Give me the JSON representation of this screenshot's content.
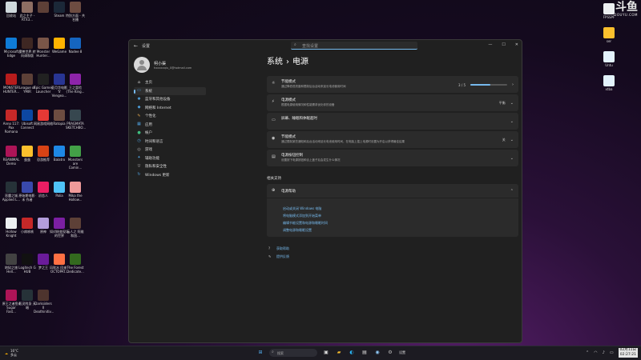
{
  "desktop_icons": [
    {
      "label": "回收站",
      "color": "#cfd8dc"
    },
    {
      "label": "此之主子 - RTX3...",
      "color": "#8d6e63"
    },
    {
      "label": "",
      "color": "#5d4037"
    },
    {
      "label": "Steam",
      "color": "#1b2838"
    },
    {
      "label": "特别方面 - 共名播",
      "color": "#6d4c41"
    },
    {
      "label": "Microsoft Edge",
      "color": "#0f7bd6"
    },
    {
      "label": "魔兽世界 转向调和版",
      "color": "#3e2723"
    },
    {
      "label": "Monster Hunter...",
      "color": "#795548"
    },
    {
      "label": "WeGame",
      "color": "#ffb300"
    },
    {
      "label": "Nadee 8",
      "color": "#1565c0"
    },
    {
      "label": "MONSTER HUNTER...",
      "color": "#b71c1c"
    },
    {
      "label": "League of YMIR",
      "color": "#5d4037"
    },
    {
      "label": "Epic Games Launcher",
      "color": "#212121"
    },
    {
      "label": "亚月华电影 'S' Vengea...",
      "color": "#283593"
    },
    {
      "label": "王之冒险 (The King...",
      "color": "#8e24aa"
    },
    {
      "label": "Anno 117: Pax Romana",
      "color": "#c62828"
    },
    {
      "label": "Ubisoft Connect",
      "color": "#0d47a1"
    },
    {
      "label": "网易游戏网络",
      "color": "#e53935"
    },
    {
      "label": "Ratopia",
      "color": "#6d4c41"
    },
    {
      "label": "PRAGMATA SKETCHBO...",
      "color": "#37474f"
    },
    {
      "label": "REANIMAL Demo",
      "color": "#ad1457"
    },
    {
      "label": "蛋蛋",
      "color": "#fbc02d"
    },
    {
      "label": "恐游推荐",
      "color": "#d84315"
    },
    {
      "label": "Balatro",
      "color": "#1e88e5"
    },
    {
      "label": "Monsters are Comin...",
      "color": "#43a047"
    },
    {
      "label": "恶魔之城 Applied L...",
      "color": "#263238"
    },
    {
      "label": "原始期电影·未 作者",
      "color": "#3949ab"
    },
    {
      "label": "初恋人",
      "color": "#e91e63"
    },
    {
      "label": "Palia",
      "color": "#4fc3f7"
    },
    {
      "label": "Mika the Hollow...",
      "color": "#ef9a9a"
    },
    {
      "label": "Hollow Knight",
      "color": "#eceff1"
    },
    {
      "label": "小病咳咳",
      "color": "#c62828"
    },
    {
      "label": "原神",
      "color": "#b39ddb"
    },
    {
      "label": "如对结变现场 的世界",
      "color": "#7b1fa2"
    },
    {
      "label": "云人之 阿维和加...",
      "color": "#5d4037"
    },
    {
      "label": "地狱之旅 Hell...",
      "color": "#424242"
    },
    {
      "label": "Logitech G HUB",
      "color": "#111"
    },
    {
      "label": "梦之王",
      "color": "#6a1b9a"
    },
    {
      "label": "风吹水 回来 - OCTOPAT...",
      "color": "#ff7043"
    },
    {
      "label": "The Forest Dedicate...",
      "color": "#33691e"
    },
    {
      "label": "原王之者鱼4 Sugar Fast...",
      "color": "#ad1457"
    },
    {
      "label": "恶灵附身 天暗",
      "color": "#263238"
    },
    {
      "label": "Darksiders II Deathinitiv...",
      "color": "#4e342e"
    }
  ],
  "right_icons": [
    {
      "label": "FPSSPF",
      "color": "#eceff1"
    },
    {
      "label": "ser",
      "color": "#fbc02d"
    },
    {
      "label": "Untu",
      "color": "#e3f2fd"
    },
    {
      "label": "xtba",
      "color": "#e3f2fd"
    }
  ],
  "watermark": {
    "big": "斗鱼",
    "small": "DOUYU.COM"
  },
  "window": {
    "back_glyph": "←",
    "app_title": "设置",
    "search_placeholder": "查找设置",
    "minimize": "—",
    "maximize": "☐",
    "close": "✕"
  },
  "profile": {
    "name": "柯小渠",
    "email": "hxxxxxqiu_0@hotmail.com"
  },
  "nav": [
    {
      "label": "主页",
      "icon": "⌂",
      "color": "#ddd"
    },
    {
      "label": "系统",
      "icon": "▭",
      "color": "#4fa3e0",
      "active": true
    },
    {
      "label": "蓝牙和其他设备",
      "icon": "✱",
      "color": "#4fa3e0"
    },
    {
      "label": "网络和 Internet",
      "icon": "◆",
      "color": "#4fa3e0"
    },
    {
      "label": "个性化",
      "icon": "✎",
      "color": "#e0a84f"
    },
    {
      "label": "应用",
      "icon": "▦",
      "color": "#4fa3e0"
    },
    {
      "label": "帐户",
      "icon": "●",
      "color": "#3fbf7f"
    },
    {
      "label": "时间和语言",
      "icon": "◷",
      "color": "#4fa3e0"
    },
    {
      "label": "游戏",
      "icon": "◎",
      "color": "#aaa"
    },
    {
      "label": "辅助功能",
      "icon": "✦",
      "color": "#4fa3e0"
    },
    {
      "label": "隐私和安全性",
      "icon": "⛨",
      "color": "#888"
    },
    {
      "label": "Windows 更新",
      "icon": "↻",
      "color": "#4fa3e0"
    }
  ],
  "breadcrumb": {
    "parent": "系统",
    "sep": "›",
    "current": "电源"
  },
  "cards": [
    {
      "icon": "☼",
      "title": "节能模式",
      "desc": "通过降低低亮度和限制后台活动来延长电池使用时间",
      "value": "3 / 5",
      "progress": 0.55,
      "type": "slider"
    },
    {
      "icon": "⚡",
      "title": "电源模式",
      "desc": "根据电源使用情况和性能需求优化你的设备",
      "value": "平衡",
      "type": "dropdown"
    },
    {
      "icon": "▭",
      "title": "屏幕、睡眠和休眠超时",
      "desc": "",
      "value": "",
      "type": "expand"
    },
    {
      "icon": "◉",
      "title": "节能模式",
      "desc": "通过限制某些通知和后台活动来延长电池使用时间，在电脑上插上电源时设置为开启以获得最佳结果",
      "value": "关",
      "type": "expand"
    },
    {
      "icon": "▤",
      "title": "电源按钮控制",
      "desc": "设置按下电源按钮和合上盖子后会发生什么情况",
      "value": "",
      "type": "expand"
    }
  ],
  "related": {
    "heading": "相关支持",
    "title": "电源帮助",
    "links": [
      "启动或关闭 Windows 电脑",
      "将电脑模式添加到开始菜单",
      "编辑节能设置和电源和睡眠时间",
      "调整电源和睡眠设置"
    ]
  },
  "help": [
    {
      "icon": "?",
      "label": "获取帮助"
    },
    {
      "icon": "✎",
      "label": "提供反馈"
    }
  ],
  "taskbar": {
    "weather_temp": "16°C",
    "weather_desc": "多云",
    "search_placeholder": "搜索",
    "active_app": "设置",
    "date": "02月11日",
    "time": "02:27:21"
  }
}
